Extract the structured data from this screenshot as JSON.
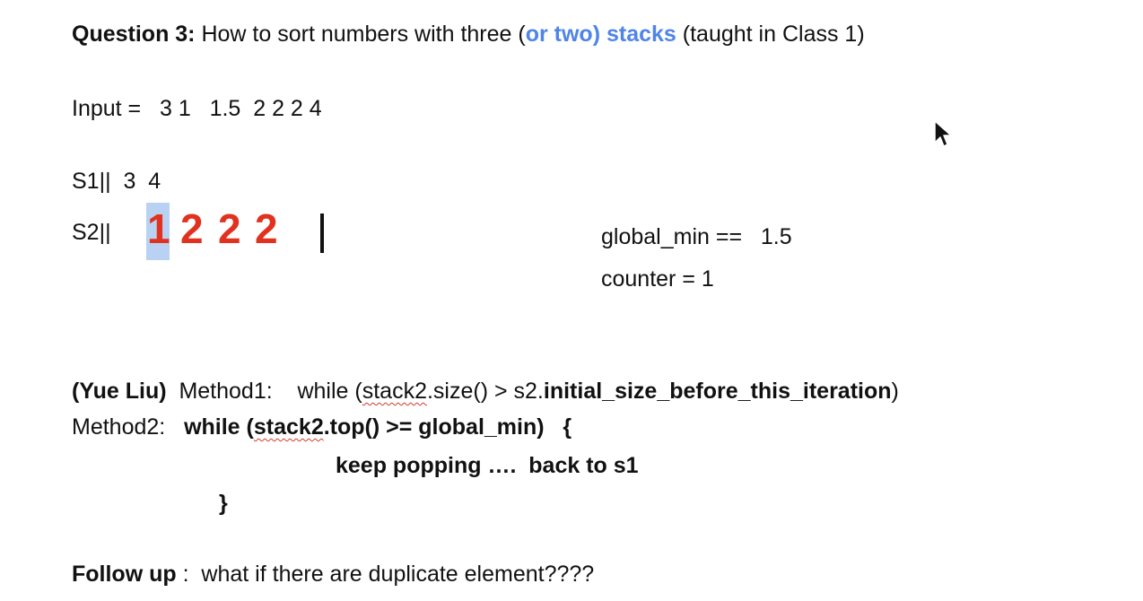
{
  "question": {
    "label": "Question 3:",
    "text_before": " How to sort numbers with three (",
    "highlight": "or two) stacks",
    "text_after": " (taught in Class 1)"
  },
  "input_line": "Input =   3 1   1.5  2 2 2 4",
  "s1_line": "S1||  3  4",
  "s2": {
    "label": "S2||",
    "digits": [
      "1",
      "2",
      "2",
      "2"
    ]
  },
  "global_min_line": "global_min ==   1.5",
  "counter_line": "counter = 1",
  "method1": {
    "author": "(Yue Liu)",
    "label": "  Method1:    while (",
    "spell": "stack2",
    "rest": ".size() > s2.",
    "bold": "initial_size_before_this_iteration",
    "end": ")"
  },
  "method2": {
    "label": "Method2:   ",
    "code_start": "while (",
    "spell": "stack2",
    "code_end": ".top() >= global_min)   {"
  },
  "keep_popping": "keep popping ….  back to s1",
  "close_brace": "}",
  "follow_up": {
    "label": "Follow up",
    "text": " :  what if there are duplicate element????"
  }
}
